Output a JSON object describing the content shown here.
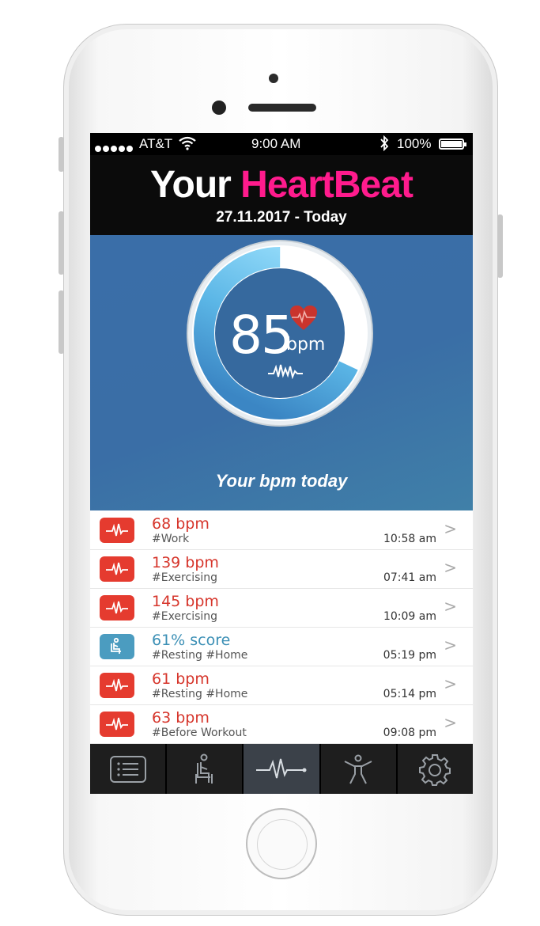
{
  "status_bar": {
    "carrier": "AT&T",
    "time": "9:00 AM",
    "battery_percent": "100%"
  },
  "header": {
    "title_part1": "Your",
    "title_part2": "HeartBeat",
    "date": "27.11.2017 - Today"
  },
  "gauge": {
    "bpm_value": "85",
    "unit": "bpm",
    "fill_fraction": 0.68,
    "caption": "Your bpm today"
  },
  "colors": {
    "accent_pink": "#ff1b8d",
    "hero_blue": "#3a6ea8",
    "alert_red": "#e53b2f",
    "resting_blue": "#4b9cc0"
  },
  "readings": [
    {
      "value": "68 bpm",
      "tags": "#Work",
      "time": "10:58 am",
      "kind": "red",
      "icon": "heartbeat-icon"
    },
    {
      "value": "139 bpm",
      "tags": "#Exercising",
      "time": "07:41 am",
      "kind": "red",
      "icon": "heartbeat-icon"
    },
    {
      "value": "145 bpm",
      "tags": "#Exercising",
      "time": "10:09 am",
      "kind": "red",
      "icon": "heartbeat-icon"
    },
    {
      "value": "61% score",
      "tags": "#Resting  #Home",
      "time": "05:19 pm",
      "kind": "blue",
      "icon": "sitting-person-icon"
    },
    {
      "value": "61 bpm",
      "tags": "#Resting  #Home",
      "time": "05:14 pm",
      "kind": "red",
      "icon": "heartbeat-icon"
    },
    {
      "value": "63 bpm",
      "tags": "#Before Workout",
      "time": "09:08 pm",
      "kind": "red",
      "icon": "heartbeat-icon"
    }
  ],
  "tabs": [
    {
      "icon": "list-icon",
      "active": false
    },
    {
      "icon": "sitting-person-icon",
      "active": false
    },
    {
      "icon": "heartbeat-icon",
      "active": true
    },
    {
      "icon": "exercise-person-icon",
      "active": false
    },
    {
      "icon": "gear-icon",
      "active": false
    }
  ]
}
